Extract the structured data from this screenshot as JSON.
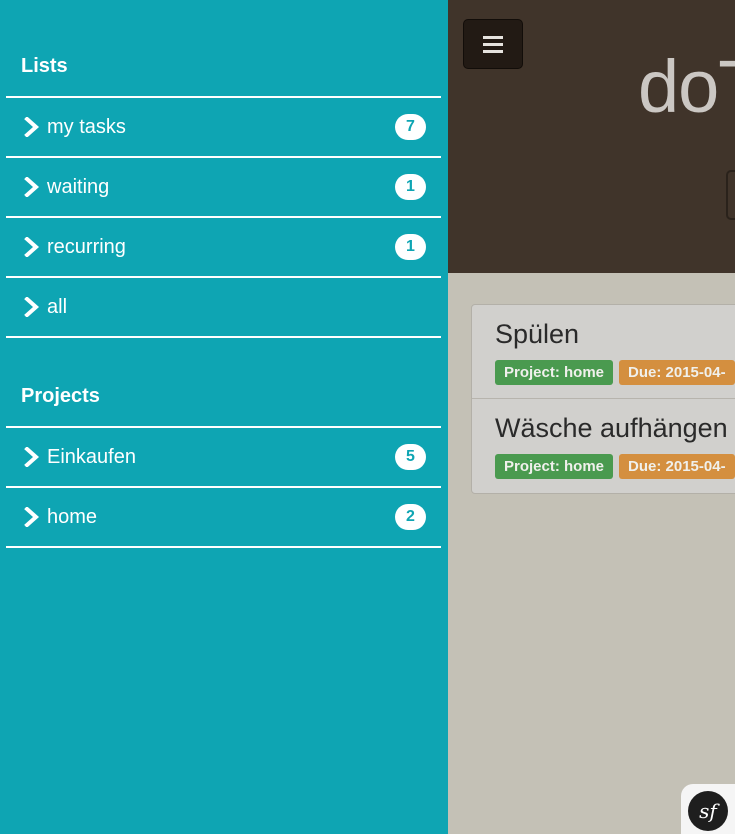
{
  "sidebar": {
    "lists_title": "Lists",
    "lists": [
      {
        "label": "my tasks",
        "count": "7"
      },
      {
        "label": "waiting",
        "count": "1"
      },
      {
        "label": "recurring",
        "count": "1"
      },
      {
        "label": "all",
        "count": null
      }
    ],
    "projects_title": "Projects",
    "projects": [
      {
        "label": "Einkaufen",
        "count": "5"
      },
      {
        "label": "home",
        "count": "2"
      }
    ]
  },
  "header": {
    "menu_icon": "hamburger-icon",
    "app_title": "doT"
  },
  "tasks": [
    {
      "title": "Spülen",
      "project_label": "Project: home",
      "due_label": "Due: 2015-04-"
    },
    {
      "title": "Wäsche aufhängen",
      "project_label": "Project: home",
      "due_label": "Due: 2015-04-"
    }
  ],
  "footer": {
    "badge_text": "sf",
    "badge_icon": "symfony-icon"
  },
  "colors": {
    "sidebar_bg": "#0ea5b3",
    "header_bg": "#40342a",
    "content_bg": "#c4c1b6",
    "project_label": "#4a9a4f",
    "due_label": "#d48f3f"
  }
}
